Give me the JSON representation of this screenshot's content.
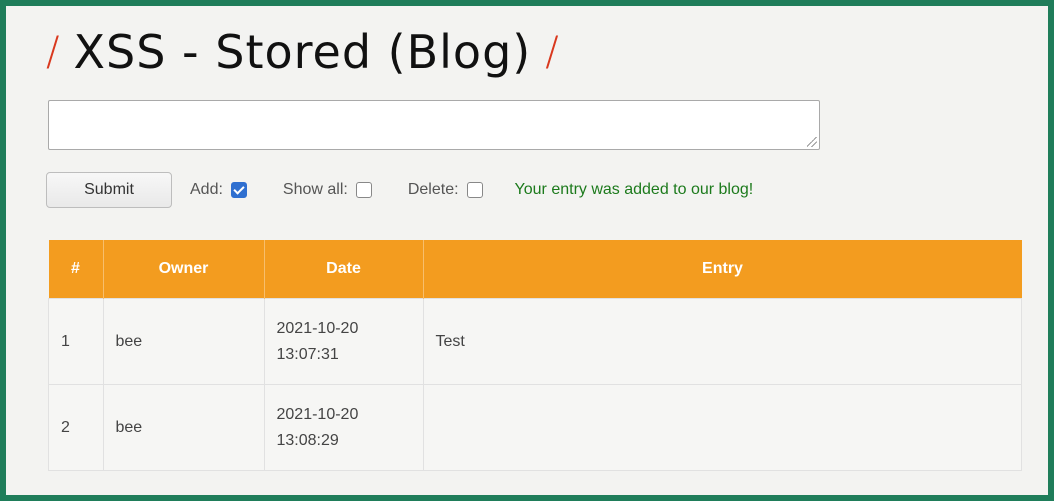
{
  "title": {
    "text": "XSS - Stored (Blog)",
    "slash": "/"
  },
  "form": {
    "submit_label": "Submit",
    "add_label": "Add:",
    "add_checked": true,
    "show_all_label": "Show all:",
    "show_all_checked": false,
    "delete_label": "Delete:",
    "delete_checked": false,
    "message": "Your entry was added to our blog!"
  },
  "table": {
    "headers": [
      "#",
      "Owner",
      "Date",
      "Entry"
    ],
    "rows": [
      {
        "num": "1",
        "owner": "bee",
        "date": "2021-10-20\n13:07:31",
        "entry": "Test"
      },
      {
        "num": "2",
        "owner": "bee",
        "date": "2021-10-20\n13:08:29",
        "entry": ""
      }
    ]
  },
  "colors": {
    "frame": "#1f7d5a",
    "header_bg": "#f39c1f",
    "slash": "#d9381e",
    "message": "#1c7a1c"
  }
}
